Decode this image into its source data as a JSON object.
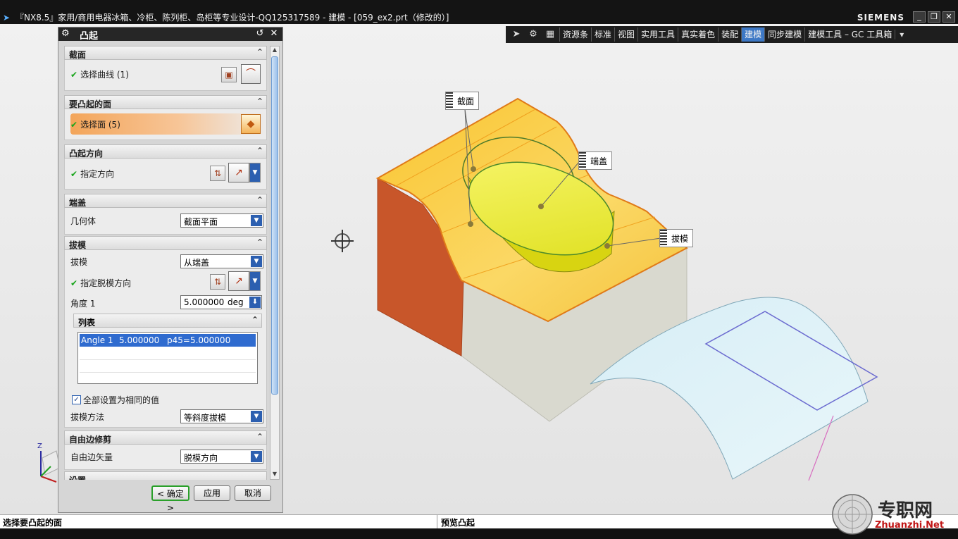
{
  "window": {
    "title": "『NX8.5』家用/商用电器冰箱、冷柜、陈列柜、岛柜等专业设计-QQ125317589 - 建模 - [059_ex2.prt（修改的）]",
    "brand": "SIEMENS",
    "min": "_",
    "restore": "❐",
    "close": "✕"
  },
  "toolbar": {
    "tabs": [
      "资源条",
      "标准",
      "视图",
      "实用工具",
      "真实着色",
      "装配",
      "建模",
      "同步建模",
      "建模工具 – GC 工具箱"
    ],
    "active": "建模",
    "overflow": "▾"
  },
  "dialog": {
    "title": "凸起",
    "sections": {
      "section": {
        "header": "截面",
        "select_curve": "选择曲线 (1)"
      },
      "faces": {
        "header": "要凸起的面",
        "select_face": "选择面 (5)"
      },
      "direction": {
        "header": "凸起方向",
        "specify": "指定方向"
      },
      "cap": {
        "header": "端盖",
        "geometry_label": "几何体",
        "geometry_value": "截面平面"
      },
      "draft": {
        "header": "拔模",
        "draft_label": "拔模",
        "draft_value": "从端盖",
        "draw_direction": "指定脱模方向",
        "angle_label": "角度 1",
        "angle_value": "5.000000",
        "angle_unit": "deg",
        "list": {
          "header": "列表",
          "rows": [
            [
              "Angle 1",
              "5.000000",
              "p45=5.000000"
            ]
          ]
        },
        "set_all_same": "全部设置为相同的值",
        "method_label": "拔模方法",
        "method_value": "等斜度拔模"
      },
      "free_edge": {
        "header": "自由边修剪",
        "vector_label": "自由边矢量",
        "vector_value": "脱模方向"
      },
      "settings": {
        "header": "设置"
      }
    },
    "buttons": {
      "ok": "< 确定 >",
      "apply": "应用",
      "cancel": "取消"
    }
  },
  "callouts": {
    "section": "截面",
    "cap": "端盖",
    "draft": "拔模"
  },
  "triad": {
    "z": "Z"
  },
  "status": {
    "prompt": "选择要凸起的面",
    "info": "预览凸起"
  },
  "watermark": {
    "cn": "专职网",
    "en": "Zhuanzhi.Net"
  },
  "colors": {
    "accent": "#3d78c5",
    "active_selection": "#f3a55a",
    "model_face": "#f9c531",
    "boss": "#eaea2a",
    "check": "#19a51c"
  }
}
